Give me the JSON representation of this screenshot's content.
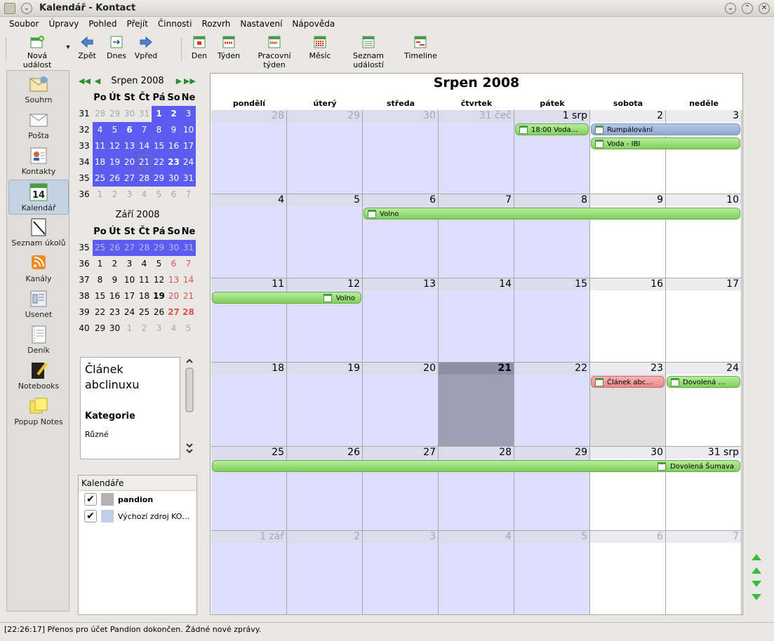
{
  "window": {
    "title": "Kalendář - Kontact",
    "menu_btn": "⌄",
    "btn_min": "⌄",
    "btn_max": "⌃",
    "btn_close": "✕"
  },
  "menu": [
    "Soubor",
    "Úpravy",
    "Pohled",
    "Přejít",
    "Činnosti",
    "Rozvrh",
    "Nastavení",
    "Nápověda"
  ],
  "toolbar": {
    "new_event": "Nová událost",
    "back": "Zpět",
    "today": "Dnes",
    "forward": "Vpřed",
    "day": "Den",
    "week": "Týden",
    "workweek": "Pracovní týden",
    "month": "Měsíc",
    "list": "Seznam událostí",
    "timeline": "Timeline"
  },
  "sidebar": [
    {
      "label": "Souhrn",
      "icon": "summary-icon"
    },
    {
      "label": "Pošta",
      "icon": "mail-icon"
    },
    {
      "label": "Kontakty",
      "icon": "contacts-icon"
    },
    {
      "label": "Kalendář",
      "icon": "calendar-icon",
      "selected": true
    },
    {
      "label": "Seznam úkolů",
      "icon": "todo-icon"
    },
    {
      "label": "Kanály",
      "icon": "feeds-icon"
    },
    {
      "label": "Usenet",
      "icon": "usenet-icon"
    },
    {
      "label": "Deník",
      "icon": "journal-icon"
    },
    {
      "label": "Notebooks",
      "icon": "notebooks-icon"
    },
    {
      "label": "Popup Notes",
      "icon": "popup-notes-icon"
    }
  ],
  "minical1": {
    "title": "Srpen 2008",
    "headers": [
      "Po",
      "Út",
      "St",
      "Čt",
      "Pá",
      "So",
      "Ne"
    ],
    "weeks": [
      "31",
      "32",
      "33",
      "34",
      "35",
      "36"
    ],
    "days": [
      [
        "28",
        "29",
        "30",
        "31",
        "1",
        "2",
        "3"
      ],
      [
        "4",
        "5",
        "6",
        "7",
        "8",
        "9",
        "10"
      ],
      [
        "11",
        "12",
        "13",
        "14",
        "15",
        "16",
        "17"
      ],
      [
        "18",
        "19",
        "20",
        "21",
        "22",
        "23",
        "24"
      ],
      [
        "25",
        "26",
        "27",
        "28",
        "29",
        "30",
        "31"
      ],
      [
        "1",
        "2",
        "3",
        "4",
        "5",
        "6",
        "7"
      ]
    ]
  },
  "minical2": {
    "title": "Září 2008",
    "headers": [
      "Po",
      "Út",
      "St",
      "Čt",
      "Pá",
      "So",
      "Ne"
    ],
    "weeks": [
      "35",
      "36",
      "37",
      "38",
      "39",
      "40"
    ],
    "days": [
      [
        "25",
        "26",
        "27",
        "28",
        "29",
        "30",
        "31"
      ],
      [
        "1",
        "2",
        "3",
        "4",
        "5",
        "6",
        "7"
      ],
      [
        "8",
        "9",
        "10",
        "11",
        "12",
        "13",
        "14"
      ],
      [
        "15",
        "16",
        "17",
        "18",
        "19",
        "20",
        "21"
      ],
      [
        "22",
        "23",
        "24",
        "25",
        "26",
        "27",
        "28"
      ],
      [
        "29",
        "30",
        "1",
        "2",
        "3",
        "4",
        "5"
      ]
    ]
  },
  "note": {
    "title": "Článek abclinuxu",
    "category_label": "Kategorie",
    "category_value": "Různé"
  },
  "calendars": {
    "header": "Kalendáře",
    "items": [
      {
        "name": "pandion",
        "color": "#b3b3b3"
      },
      {
        "name": "Výchozí zdroj KO…",
        "color": "#c0d0e6"
      }
    ]
  },
  "month": {
    "title": "Srpen 2008",
    "weekdays": [
      "pondělí",
      "úterý",
      "středa",
      "čtvrtek",
      "pátek",
      "sobota",
      "neděle"
    ],
    "days": [
      [
        "28",
        "29",
        "30",
        "31 čeč",
        "1 srp",
        "2",
        "3"
      ],
      [
        "4",
        "5",
        "6",
        "7",
        "8",
        "9",
        "10"
      ],
      [
        "11",
        "12",
        "13",
        "14",
        "15",
        "16",
        "17"
      ],
      [
        "18",
        "19",
        "20",
        "21",
        "22",
        "23",
        "24"
      ],
      [
        "25",
        "26",
        "27",
        "28",
        "29",
        "30",
        "31 srp"
      ],
      [
        "1 zář",
        "2",
        "3",
        "4",
        "5",
        "6",
        "7"
      ]
    ],
    "events": [
      {
        "text": "18:00 Voda…",
        "color": "green"
      },
      {
        "text": "Rumpálování",
        "color": "blue"
      },
      {
        "text": "Voda - IBI",
        "color": "green"
      },
      {
        "text": "Volno",
        "color": "green"
      },
      {
        "text": "Volno",
        "color": "green"
      },
      {
        "text": "Článek abc…",
        "color": "red"
      },
      {
        "text": "Dovolená …",
        "color": "green"
      },
      {
        "text": "Dovolená Šumava",
        "color": "green"
      }
    ]
  },
  "status": "[22:26:17] Přenos pro účet Pandion dokončen. Žádné nové zprávy."
}
